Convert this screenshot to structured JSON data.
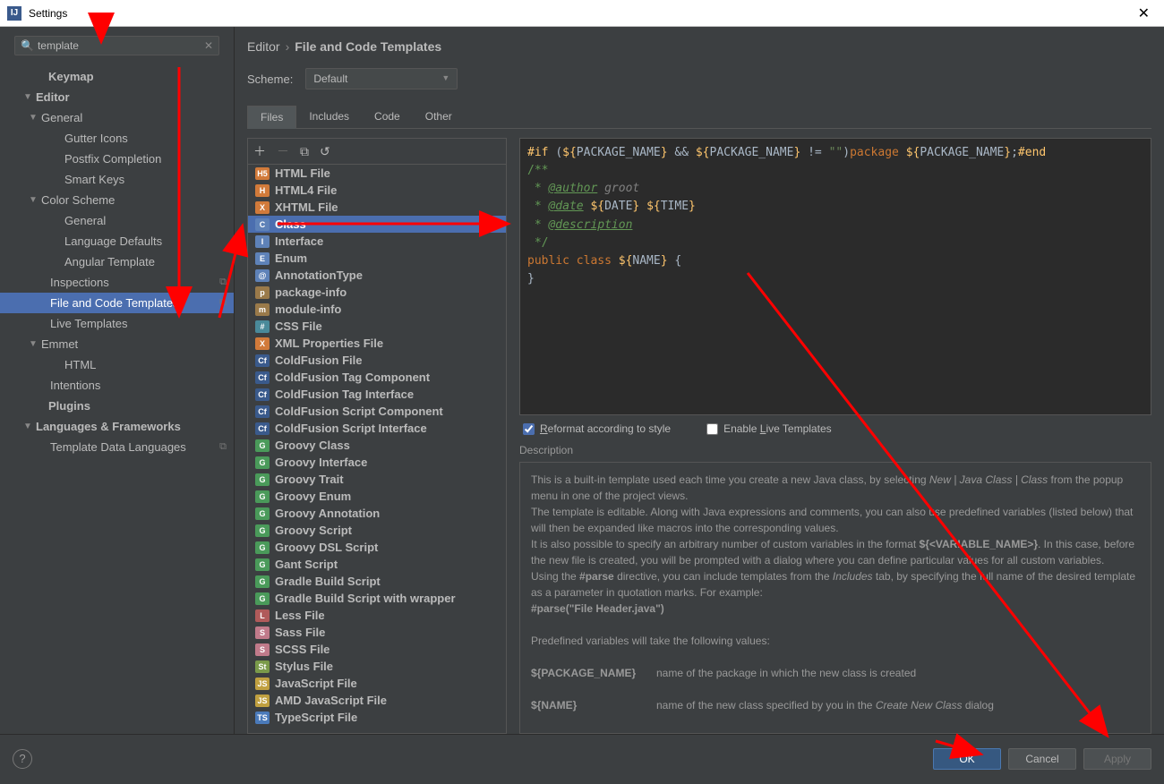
{
  "window": {
    "title": "Settings"
  },
  "search": {
    "value": "template"
  },
  "tree": {
    "keymap": "Keymap",
    "editor": "Editor",
    "general": "General",
    "gutter_icons": "Gutter Icons",
    "postfix": "Postfix Completion",
    "smart_keys": "Smart Keys",
    "color_scheme": "Color Scheme",
    "general2": "General",
    "lang_defaults": "Language Defaults",
    "angular": "Angular Template",
    "inspections": "Inspections",
    "file_code": "File and Code Templates",
    "live": "Live Templates",
    "emmet": "Emmet",
    "html": "HTML",
    "intentions": "Intentions",
    "plugins": "Plugins",
    "langs": "Languages & Frameworks",
    "tdl": "Template Data Languages"
  },
  "breadcrumb": {
    "a": "Editor",
    "b": "File and Code Templates"
  },
  "scheme": {
    "label": "Scheme:",
    "value": "Default"
  },
  "tabs": {
    "files": "Files",
    "includes": "Includes",
    "code": "Code",
    "other": "Other"
  },
  "templates": [
    {
      "icon": "H5",
      "c": "#d17a3a",
      "t": "HTML File"
    },
    {
      "icon": "H",
      "c": "#d17a3a",
      "t": "HTML4 File"
    },
    {
      "icon": "X",
      "c": "#d17a3a",
      "t": "XHTML File"
    },
    {
      "icon": "C",
      "c": "#5e82b8",
      "t": "Class",
      "sel": true
    },
    {
      "icon": "I",
      "c": "#5e82b8",
      "t": "Interface"
    },
    {
      "icon": "E",
      "c": "#5e82b8",
      "t": "Enum"
    },
    {
      "icon": "@",
      "c": "#5e82b8",
      "t": "AnnotationType"
    },
    {
      "icon": "p",
      "c": "#9a7a4a",
      "t": "package-info"
    },
    {
      "icon": "m",
      "c": "#9a7a4a",
      "t": "module-info"
    },
    {
      "icon": "#",
      "c": "#4a8a9a",
      "t": "CSS File"
    },
    {
      "icon": "X",
      "c": "#d17a3a",
      "t": "XML Properties File"
    },
    {
      "icon": "Cf",
      "c": "#3a5a8c",
      "t": "ColdFusion File"
    },
    {
      "icon": "Cf",
      "c": "#3a5a8c",
      "t": "ColdFusion Tag Component"
    },
    {
      "icon": "Cf",
      "c": "#3a5a8c",
      "t": "ColdFusion Tag Interface"
    },
    {
      "icon": "Cf",
      "c": "#3a5a8c",
      "t": "ColdFusion Script Component"
    },
    {
      "icon": "Cf",
      "c": "#3a5a8c",
      "t": "ColdFusion Script Interface"
    },
    {
      "icon": "G",
      "c": "#4a9a5a",
      "t": "Groovy Class"
    },
    {
      "icon": "G",
      "c": "#4a9a5a",
      "t": "Groovy Interface"
    },
    {
      "icon": "G",
      "c": "#4a9a5a",
      "t": "Groovy Trait"
    },
    {
      "icon": "G",
      "c": "#4a9a5a",
      "t": "Groovy Enum"
    },
    {
      "icon": "G",
      "c": "#4a9a5a",
      "t": "Groovy Annotation"
    },
    {
      "icon": "G",
      "c": "#4a9a5a",
      "t": "Groovy Script"
    },
    {
      "icon": "G",
      "c": "#4a9a5a",
      "t": "Groovy DSL Script"
    },
    {
      "icon": "G",
      "c": "#4a9a5a",
      "t": "Gant Script"
    },
    {
      "icon": "G",
      "c": "#4a9a5a",
      "t": "Gradle Build Script"
    },
    {
      "icon": "G",
      "c": "#4a9a5a",
      "t": "Gradle Build Script with wrapper"
    },
    {
      "icon": "L",
      "c": "#b05a5a",
      "t": "Less File"
    },
    {
      "icon": "S",
      "c": "#c07a8a",
      "t": "Sass File"
    },
    {
      "icon": "S",
      "c": "#c07a8a",
      "t": "SCSS File"
    },
    {
      "icon": "St",
      "c": "#7a9a4a",
      "t": "Stylus File"
    },
    {
      "icon": "JS",
      "c": "#c0a040",
      "t": "JavaScript File"
    },
    {
      "icon": "JS",
      "c": "#c0a040",
      "t": "AMD JavaScript File"
    },
    {
      "icon": "TS",
      "c": "#4a7aba",
      "t": "TypeScript File"
    }
  ],
  "checks": {
    "reformat": "Reformat according to style",
    "live": "Enable Live Templates"
  },
  "desc": {
    "label": "Description",
    "p1a": "This is a built-in template used each time you create a new Java class, by selecting ",
    "p1b": "New | Java Class | Class",
    "p1c": " from the popup menu in one of the project views.",
    "p2": "The template is editable. Along with Java expressions and comments, you can also use predefined variables (listed below) that will then be expanded like macros into the corresponding values.",
    "p3a": "It is also possible to specify an arbitrary number of custom variables in the format ",
    "p3b": "${<VARIABLE_NAME>}",
    "p3c": ". In this case, before the new file is created, you will be prompted with a dialog where you can define particular values for all custom variables.",
    "p4a": "Using the ",
    "p4b": "#parse",
    "p4c": " directive, you can include templates from the ",
    "p4d": "Includes",
    "p4e": " tab, by specifying the full name of the desired template as a parameter in quotation marks. For example:",
    "p5": "#parse(\"File Header.java\")",
    "p6": "Predefined variables will take the following values:",
    "v1": "${PACKAGE_NAME}",
    "v1d": "name of the package in which the new class is created",
    "v2": "${NAME}",
    "v2d": "name of the new class specified by you in the ",
    "v2e": "Create New Class",
    "v2f": " dialog"
  },
  "footer": {
    "ok": "OK",
    "cancel": "Cancel",
    "apply": "Apply"
  }
}
